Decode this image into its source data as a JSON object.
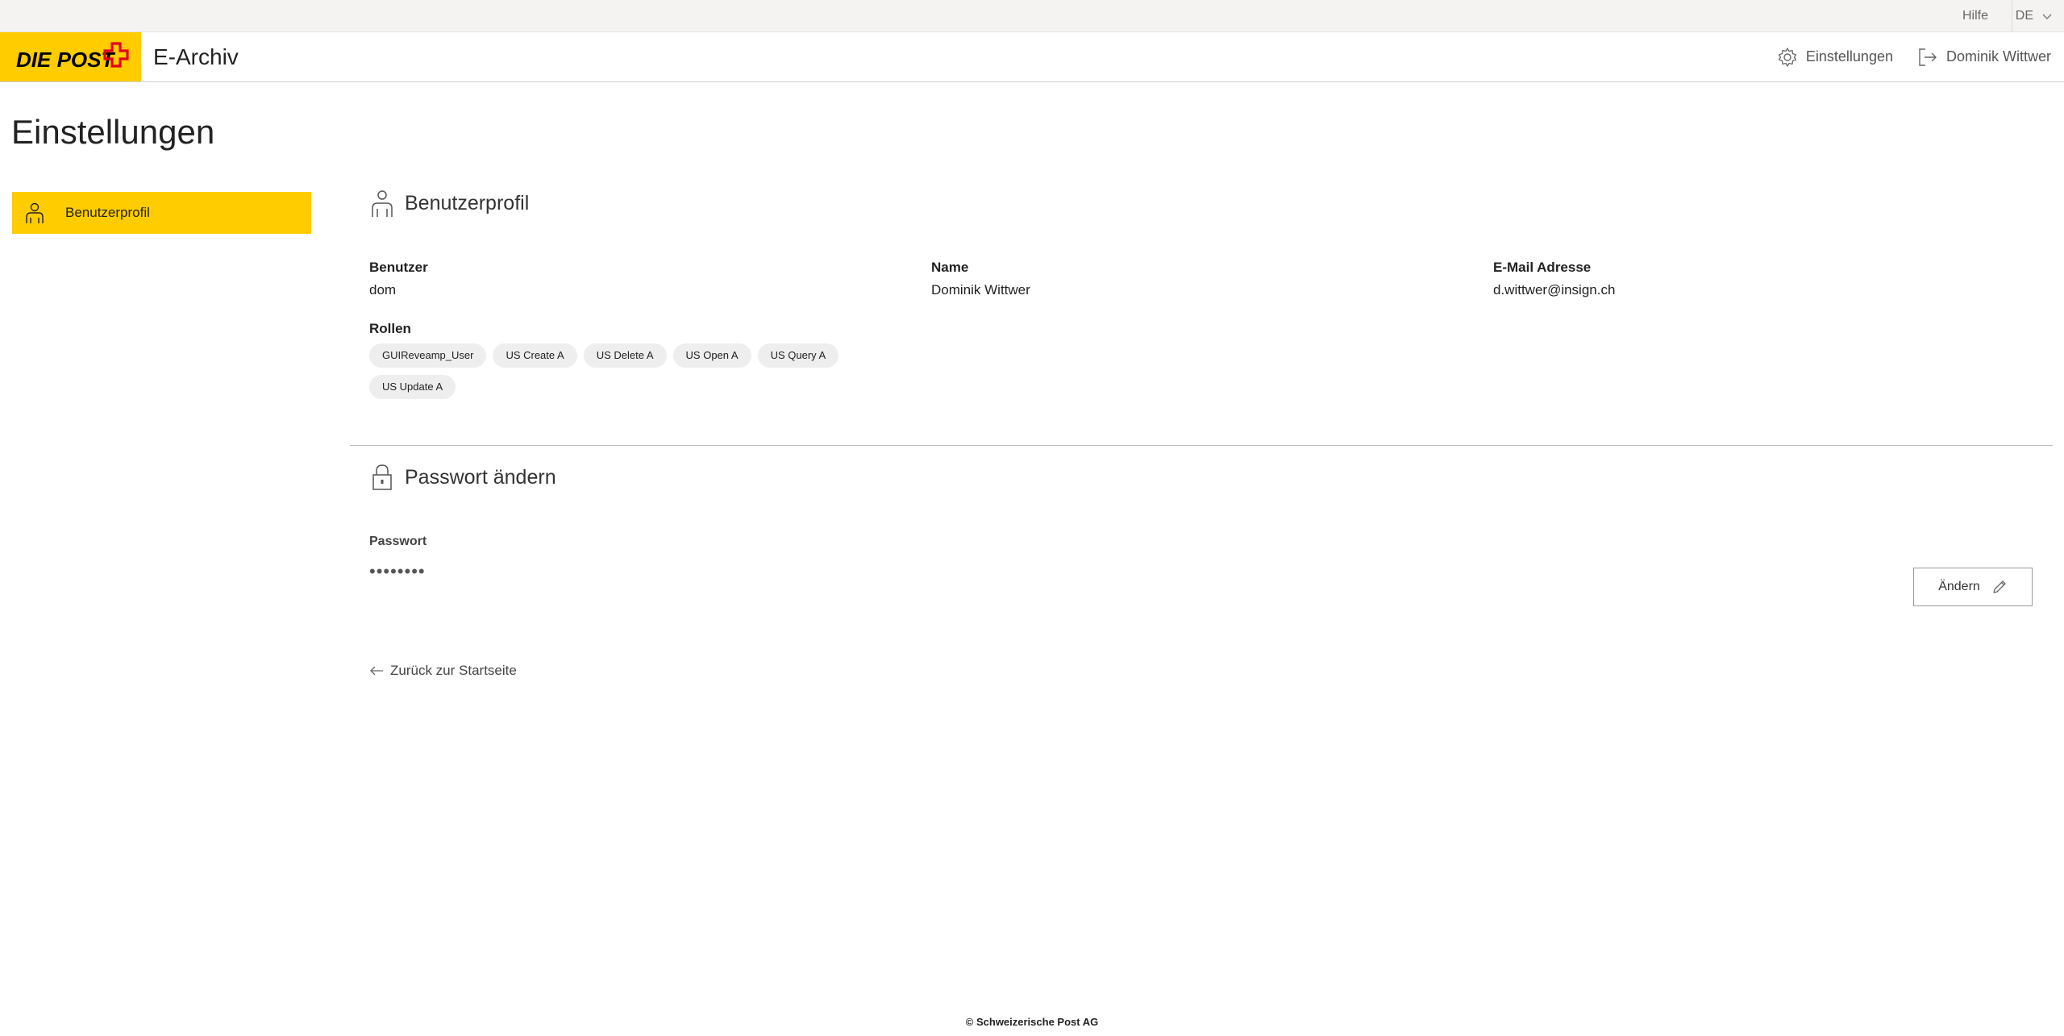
{
  "topbar": {
    "help": "Hilfe",
    "language": "DE"
  },
  "header": {
    "logo_text": "DIE POST",
    "app_title": "E-Archiv",
    "settings_link": "Einstellungen",
    "user_link": "Dominik Wittwer"
  },
  "page": {
    "title": "Einstellungen"
  },
  "sidebar": {
    "items": [
      {
        "label": "Benutzerprofil",
        "icon": "user-icon",
        "active": true
      }
    ]
  },
  "profile": {
    "heading": "Benutzerprofil",
    "user_label": "Benutzer",
    "user_value": "dom",
    "name_label": "Name",
    "name_value": "Dominik Wittwer",
    "email_label": "E-Mail Adresse",
    "email_value": "d.wittwer@insign.ch",
    "roles_label": "Rollen",
    "roles": [
      "GUIReveamp_User",
      "US Create A",
      "US Delete A",
      "US Open A",
      "US Query A",
      "US Update A"
    ]
  },
  "password": {
    "heading": "Passwort ändern",
    "label": "Passwort",
    "masked_value": "••••••••",
    "change_button": "Ändern"
  },
  "back_link": "Zurück zur Startseite",
  "footer": "© Schweizerische Post AG",
  "colors": {
    "brand_yellow": "#ffcc00",
    "brand_red": "#e2001a",
    "chip_bg": "#eeeeee"
  }
}
